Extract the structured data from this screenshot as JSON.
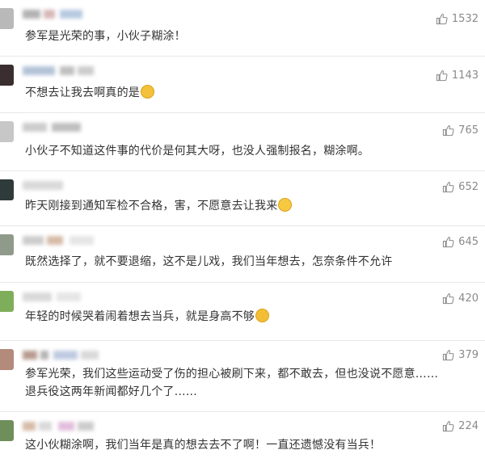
{
  "comments": [
    {
      "text": "参军是光荣的事，小伙子糊涂！",
      "emoji": "",
      "likes": "1532"
    },
    {
      "text": "不想去让我去啊真的是",
      "emoji": "crying-face-emoji",
      "likes": "1143"
    },
    {
      "text": "小伙子不知道这件事的代价是何其大呀，也没人强制报名，糊涂啊。",
      "emoji": "",
      "likes": "765"
    },
    {
      "text": "昨天刚接到通知军检不合格，害，不愿意去让我来",
      "emoji": "flushed-face-emoji",
      "likes": "652"
    },
    {
      "text": "既然选择了，就不要退缩，这不是儿戏，我们当年想去，怎奈条件不允许",
      "emoji": "",
      "likes": "645"
    },
    {
      "text": "年轻的时候哭着闹着想去当兵，就是身高不够",
      "emoji": "sad-face-emoji",
      "likes": "420"
    },
    {
      "text": "参军光荣，我们这些运动受了伤的担心被刷下来，都不敢去，但也没说不愿意……\n退兵役这两年新闻都好几个了……",
      "emoji": "",
      "likes": "379"
    },
    {
      "text": "这小伙糊涂啊，我们当年是真的想去去不了啊！一直还遗憾没有当兵！",
      "emoji": "",
      "likes": "224"
    }
  ],
  "colors": {
    "text": "#333333",
    "like_count": "#8a8a8a",
    "divider": "#e8e8e8",
    "emoji": "#f5c33b"
  },
  "icons": {
    "like": "thumbs-up-icon"
  }
}
